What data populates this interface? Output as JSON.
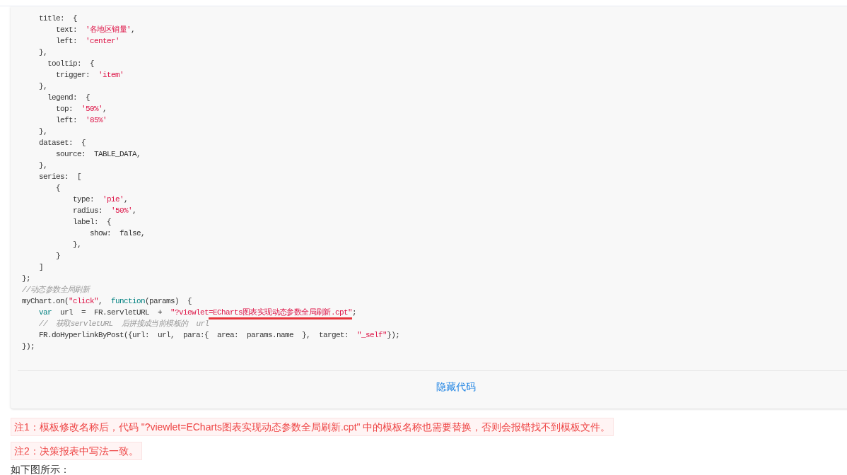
{
  "code_block": {
    "lines": [
      {
        "tokens": [
          {
            "text": "    title:  {",
            "kind": "plain",
            "underlined": false
          }
        ]
      },
      {
        "tokens": [
          {
            "text": "        text:  ",
            "kind": "plain",
            "underlined": false
          },
          {
            "text": "'各地区销量'",
            "kind": "string",
            "underlined": false
          },
          {
            "text": ",",
            "kind": "plain",
            "underlined": false
          }
        ]
      },
      {
        "tokens": [
          {
            "text": "        left:  ",
            "kind": "plain",
            "underlined": false
          },
          {
            "text": "'center'",
            "kind": "string",
            "underlined": false
          }
        ]
      },
      {
        "tokens": [
          {
            "text": "    },",
            "kind": "plain",
            "underlined": false
          }
        ]
      },
      {
        "tokens": [
          {
            "text": "      tooltip:  {",
            "kind": "plain",
            "underlined": false
          }
        ]
      },
      {
        "tokens": [
          {
            "text": "        trigger:  ",
            "kind": "plain",
            "underlined": false
          },
          {
            "text": "'item'",
            "kind": "string",
            "underlined": false
          }
        ]
      },
      {
        "tokens": [
          {
            "text": "    },",
            "kind": "plain",
            "underlined": false
          }
        ]
      },
      {
        "tokens": [
          {
            "text": "      legend:  {",
            "kind": "plain",
            "underlined": false
          }
        ]
      },
      {
        "tokens": [
          {
            "text": "        top:  ",
            "kind": "plain",
            "underlined": false
          },
          {
            "text": "'50%'",
            "kind": "string",
            "underlined": false
          },
          {
            "text": ",",
            "kind": "plain",
            "underlined": false
          }
        ]
      },
      {
        "tokens": [
          {
            "text": "        left:  ",
            "kind": "plain",
            "underlined": false
          },
          {
            "text": "'85%'",
            "kind": "string",
            "underlined": false
          }
        ]
      },
      {
        "tokens": [
          {
            "text": "    },",
            "kind": "plain",
            "underlined": false
          }
        ]
      },
      {
        "tokens": [
          {
            "text": "    dataset:  {",
            "kind": "plain",
            "underlined": false
          }
        ]
      },
      {
        "tokens": [
          {
            "text": "        source:  TABLE_DATA,",
            "kind": "plain",
            "underlined": false
          }
        ]
      },
      {
        "tokens": [
          {
            "text": "    },",
            "kind": "plain",
            "underlined": false
          }
        ]
      },
      {
        "tokens": [
          {
            "text": "    series:  [",
            "kind": "plain",
            "underlined": false
          }
        ]
      },
      {
        "tokens": [
          {
            "text": "        {",
            "kind": "plain",
            "underlined": false
          }
        ]
      },
      {
        "tokens": [
          {
            "text": "            type:  ",
            "kind": "plain",
            "underlined": false
          },
          {
            "text": "'pie'",
            "kind": "string",
            "underlined": false
          },
          {
            "text": ",",
            "kind": "plain",
            "underlined": false
          }
        ]
      },
      {
        "tokens": [
          {
            "text": "            radius:  ",
            "kind": "plain",
            "underlined": false
          },
          {
            "text": "'50%'",
            "kind": "string",
            "underlined": false
          },
          {
            "text": ",",
            "kind": "plain",
            "underlined": false
          }
        ]
      },
      {
        "tokens": [
          {
            "text": "            label:  {",
            "kind": "plain",
            "underlined": false
          }
        ]
      },
      {
        "tokens": [
          {
            "text": "                show:  false,",
            "kind": "plain",
            "underlined": false
          }
        ]
      },
      {
        "tokens": [
          {
            "text": "            },",
            "kind": "plain",
            "underlined": false
          }
        ]
      },
      {
        "tokens": [
          {
            "text": "        }",
            "kind": "plain",
            "underlined": false
          }
        ]
      },
      {
        "tokens": [
          {
            "text": "    ]",
            "kind": "plain",
            "underlined": false
          }
        ]
      },
      {
        "tokens": [
          {
            "text": "};",
            "kind": "plain",
            "underlined": false
          }
        ]
      },
      {
        "tokens": [
          {
            "text": "//动态参数全局刷新",
            "kind": "comment",
            "underlined": false
          }
        ]
      },
      {
        "tokens": [
          {
            "text": "myChart.on(",
            "kind": "plain",
            "underlined": false
          },
          {
            "text": "\"click\"",
            "kind": "string",
            "underlined": false
          },
          {
            "text": ",  ",
            "kind": "plain",
            "underlined": false
          },
          {
            "text": "function",
            "kind": "keyword",
            "underlined": false
          },
          {
            "text": "(params)  {",
            "kind": "plain",
            "underlined": false
          }
        ]
      },
      {
        "tokens": [
          {
            "text": "    var",
            "kind": "keyword",
            "underlined": false
          },
          {
            "text": "  url  =  FR.servletURL  +  ",
            "kind": "plain",
            "underlined": false
          },
          {
            "text": "\"?viewlet",
            "kind": "string",
            "underlined": false
          },
          {
            "text": "=ECharts图表实现动态参数全局刷新.cpt\"",
            "kind": "string",
            "underlined": true
          },
          {
            "text": ";",
            "kind": "plain",
            "underlined": false
          }
        ]
      },
      {
        "tokens": [
          {
            "text": "    //  获取servletURL  后拼接成当前模板的  url",
            "kind": "comment",
            "underlined": false
          }
        ]
      },
      {
        "tokens": [
          {
            "text": "    FR.doHyperlinkByPost({url:  url,  para:{  area:  params.name  },  target:  ",
            "kind": "plain",
            "underlined": false
          },
          {
            "text": "\"_self\"",
            "kind": "string",
            "underlined": false
          },
          {
            "text": "});",
            "kind": "plain",
            "underlined": false
          }
        ]
      },
      {
        "tokens": [
          {
            "text": "});",
            "kind": "plain",
            "underlined": false
          }
        ]
      }
    ],
    "toggle_label": "隐藏代码"
  },
  "notes": [
    "注1：模板修改名称后，代码 \"?viewlet=ECharts图表实现动态参数全局刷新.cpt\" 中的模板名称也需要替换，否则会报错找不到模板文件。",
    "注2：决策报表中写法一致。"
  ],
  "paragraph": "如下图所示："
}
